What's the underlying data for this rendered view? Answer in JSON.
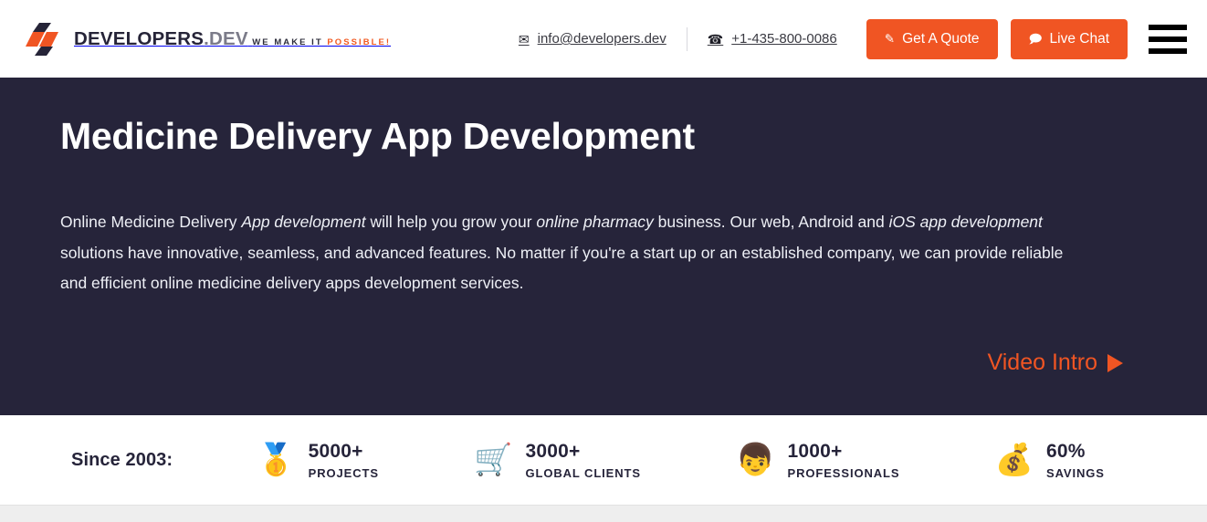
{
  "header": {
    "brand": {
      "name_primary": "DEVELOPERS",
      "name_secondary": ".DEV",
      "tagline_primary": "WE MAKE IT ",
      "tagline_accent": "POSSIBLE!",
      "logo_icon": "developers-dev-logo-mark"
    },
    "contacts": [
      {
        "icon": "envelope-icon",
        "glyph": "✉",
        "text": "info@developers.dev"
      },
      {
        "icon": "telephone-icon",
        "glyph": "☎",
        "text": "+1-435-800-0086"
      }
    ],
    "buttons": {
      "quote": {
        "label": "Get A Quote",
        "icon": "pencil-icon",
        "glyph": "✎"
      },
      "chat": {
        "label": "Live Chat",
        "icon": "speech-bubble-icon",
        "glyph": "🗩"
      }
    },
    "menu": {
      "icon": "hamburger-menu-icon",
      "label": "Menu"
    },
    "accent_color": "#f05523"
  },
  "hero": {
    "title": "Medicine Delivery App Development",
    "paragraph": {
      "seg1": "Online Medicine Delivery ",
      "em1": "App development",
      "seg2": " will help you grow your ",
      "em2": "online pharmacy",
      "seg3": " business. Our web, Android and ",
      "em3": "iOS app development",
      "seg4": " solutions have innovative, seamless, and advanced features. No matter if you're a start up or an established company, we can provide reliable and efficient online medicine delivery apps development services."
    },
    "video_link": {
      "label": "Video Intro",
      "icon": "play-triangle-icon"
    },
    "background_color": "#26243a"
  },
  "stats": {
    "since_label": "Since 2003:",
    "items": [
      {
        "icon": "gold-medal-icon",
        "glyph": "🥇",
        "value": "5000+",
        "label": "PROJECTS"
      },
      {
        "icon": "shopping-cart-icon",
        "glyph": "🛒",
        "value": "3000+",
        "label": "GLOBAL CLIENTS"
      },
      {
        "icon": "person-icon",
        "glyph": "👦",
        "value": "1000+",
        "label": "PROFESSIONALS"
      },
      {
        "icon": "money-bag-icon",
        "glyph": "💰",
        "value": "60%",
        "label": "SAVINGS"
      }
    ]
  }
}
